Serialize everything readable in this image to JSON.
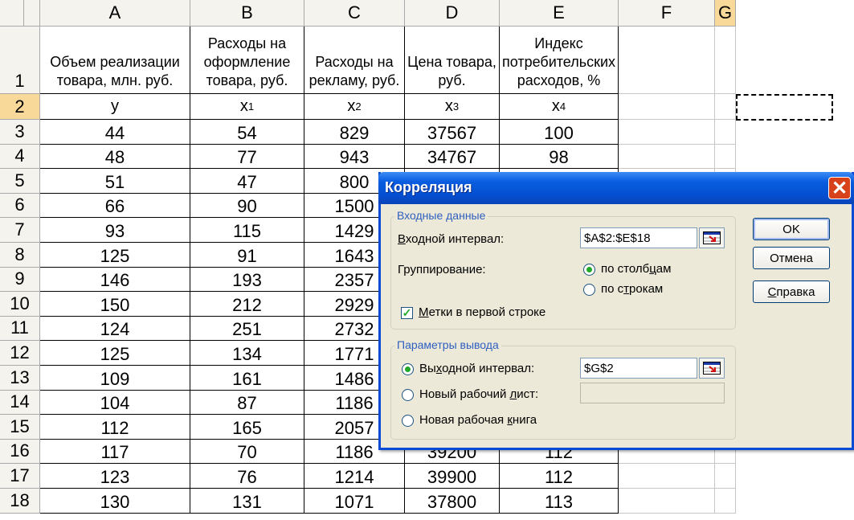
{
  "sheet": {
    "columns": [
      "A",
      "B",
      "C",
      "D",
      "E",
      "F",
      "G"
    ],
    "selected_column": "G",
    "selected_row": "2",
    "headers": [
      "Объем реализации товара, млн. руб.",
      "Расходы на оформление товара, руб.",
      "Расходы на рекламу, руб.",
      "Цена товара, руб.",
      "Индекс потребительских расходов, %"
    ],
    "variables": [
      {
        "base": "y",
        "sub": ""
      },
      {
        "base": "x",
        "sub": "1"
      },
      {
        "base": "x",
        "sub": "2"
      },
      {
        "base": "x",
        "sub": "3"
      },
      {
        "base": "x",
        "sub": "4"
      }
    ],
    "rows": [
      {
        "num": "3",
        "cells": [
          "44",
          "54",
          "829",
          "37567",
          "100"
        ]
      },
      {
        "num": "4",
        "cells": [
          "48",
          "77",
          "943",
          "34767",
          "98"
        ]
      },
      {
        "num": "5",
        "cells": [
          "51",
          "47",
          "800",
          "",
          ""
        ]
      },
      {
        "num": "6",
        "cells": [
          "66",
          "90",
          "1500",
          "",
          ""
        ]
      },
      {
        "num": "7",
        "cells": [
          "93",
          "115",
          "1429",
          "",
          ""
        ]
      },
      {
        "num": "8",
        "cells": [
          "125",
          "91",
          "1643",
          "",
          ""
        ]
      },
      {
        "num": "9",
        "cells": [
          "146",
          "193",
          "2357",
          "",
          ""
        ]
      },
      {
        "num": "10",
        "cells": [
          "150",
          "212",
          "2929",
          "",
          ""
        ]
      },
      {
        "num": "11",
        "cells": [
          "124",
          "251",
          "2732",
          "",
          ""
        ]
      },
      {
        "num": "12",
        "cells": [
          "125",
          "134",
          "1771",
          "",
          ""
        ]
      },
      {
        "num": "13",
        "cells": [
          "109",
          "161",
          "1486",
          "",
          ""
        ]
      },
      {
        "num": "14",
        "cells": [
          "104",
          "87",
          "1186",
          "",
          ""
        ]
      },
      {
        "num": "15",
        "cells": [
          "112",
          "165",
          "2057",
          "",
          ""
        ]
      },
      {
        "num": "16",
        "cells": [
          "117",
          "70",
          "1186",
          "39200",
          "112"
        ]
      },
      {
        "num": "17",
        "cells": [
          "123",
          "76",
          "1214",
          "39900",
          "112"
        ]
      },
      {
        "num": "18",
        "cells": [
          "130",
          "131",
          "1071",
          "37800",
          "113"
        ]
      }
    ]
  },
  "dialog": {
    "title": "Корреляция",
    "close_glyph": "✕",
    "input_group": {
      "legend": "Входные данные",
      "input_range_label_u": "В",
      "input_range_label_rest": "ходной интервал:",
      "input_range_value": "$A$2:$E$18",
      "grouping_label": "Группирование:",
      "by_columns_label_pre": "по столб",
      "by_columns_label_u": "ц",
      "by_columns_label_post": "ам",
      "by_rows_label_pre": "по с",
      "by_rows_label_u": "т",
      "by_rows_label_post": "рокам",
      "grouping_selected": "columns",
      "labels_first_row_u": "М",
      "labels_first_row_rest": "етки в первой строке",
      "labels_first_row_checked": true
    },
    "output_group": {
      "legend": "Параметры вывода",
      "output_range_label_pre": "Вы",
      "output_range_label_u": "х",
      "output_range_label_post": "одной интервал:",
      "output_range_value": "$G$2",
      "new_sheet_label_pre": "Новый рабочий ",
      "new_sheet_label_u": "л",
      "new_sheet_label_post": "ист:",
      "new_sheet_value": "",
      "new_book_label_pre": "Новая рабочая ",
      "new_book_label_u": "к",
      "new_book_label_post": "нига",
      "selected": "output_range"
    },
    "buttons": {
      "ok": "OK",
      "cancel": "Отмена",
      "help_u": "С",
      "help_rest": "правка"
    }
  }
}
